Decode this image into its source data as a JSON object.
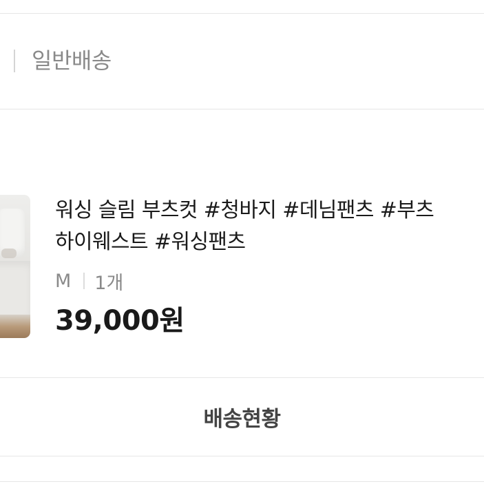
{
  "shipping": {
    "method_label": "일반배송"
  },
  "product": {
    "title_line1": "워싱 슬림 부츠컷 #청바지 #데님팬츠 #부츠",
    "title_line2": "하이웨스트 #워싱팬츠",
    "option_size": "M",
    "option_quantity": "1개",
    "price": "39,000원",
    "thumbnail_alt": "상품 이미지"
  },
  "actions": {
    "track_label": "배송현황"
  },
  "colors": {
    "divider": "#e6e6e6",
    "muted_text": "#8a8a8a",
    "primary_text": "#1a1a1a",
    "button_text": "#444444"
  }
}
